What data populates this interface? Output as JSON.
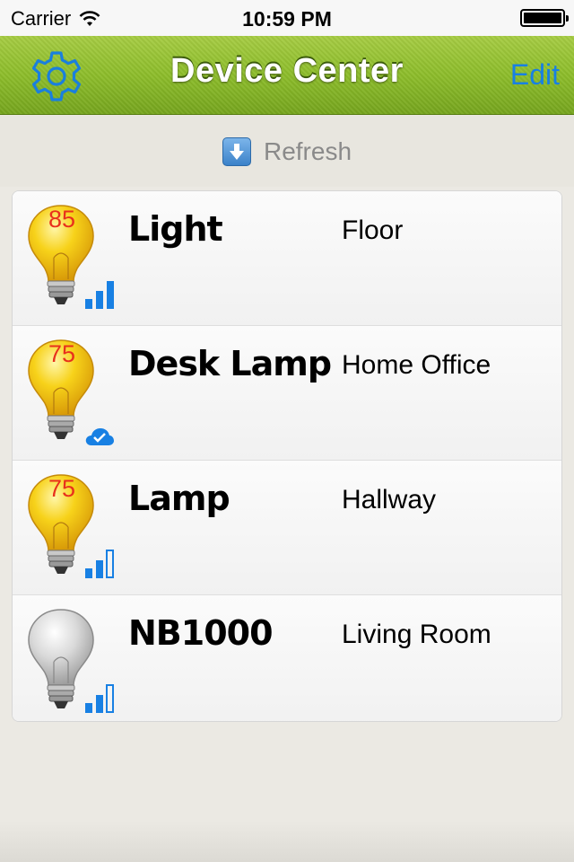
{
  "status_bar": {
    "carrier": "Carrier",
    "time": "10:59 PM"
  },
  "nav": {
    "title": "Device Center",
    "edit_label": "Edit",
    "settings_icon": "gear-icon"
  },
  "refresh": {
    "label": "Refresh",
    "icon": "down-arrow-icon"
  },
  "colors": {
    "nav_green": "#8dbd2b",
    "accent_blue": "#1880e3",
    "brightness_red": "#e8311c",
    "bulb_on": "#f2c20f",
    "bulb_off": "#c8c8c8"
  },
  "devices": [
    {
      "name": "Light",
      "location": "Floor",
      "brightness": "85",
      "state": "on",
      "status_icon": "signal-icon",
      "signal_bars": 3
    },
    {
      "name": "Desk Lamp",
      "location": "Home Office",
      "brightness": "75",
      "state": "on",
      "status_icon": "cloud-check-icon"
    },
    {
      "name": "Lamp",
      "location": "Hallway",
      "brightness": "75",
      "state": "on",
      "status_icon": "signal-icon",
      "signal_bars": 2
    },
    {
      "name": "NB1000",
      "location": "Living Room",
      "brightness": "",
      "state": "off",
      "status_icon": "signal-icon",
      "signal_bars": 2
    }
  ]
}
